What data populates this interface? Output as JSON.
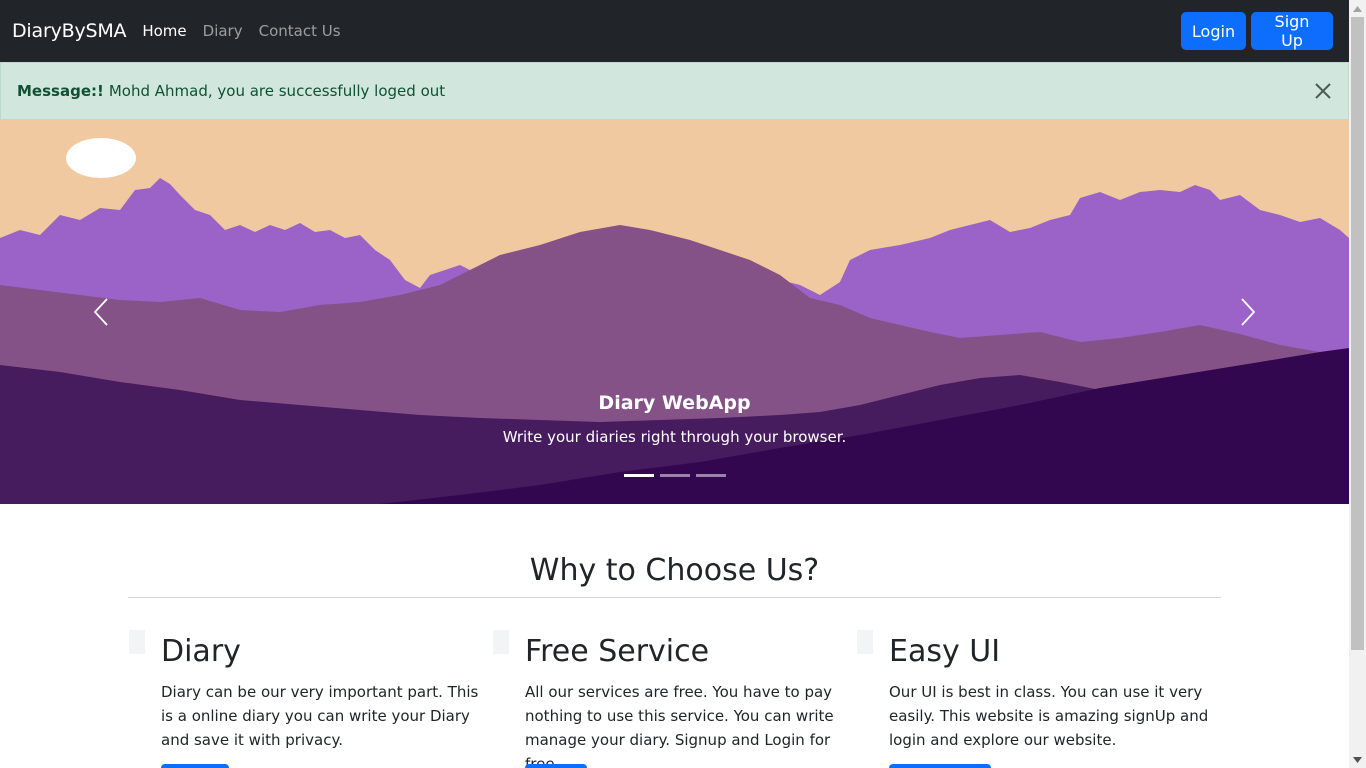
{
  "navbar": {
    "brand": "DiaryBySMA",
    "links": [
      {
        "label": "Home",
        "active": true
      },
      {
        "label": "Diary",
        "active": false
      },
      {
        "label": "Contact Us",
        "active": false
      }
    ],
    "login_label": "Login",
    "signup_label": "Sign Up"
  },
  "alert": {
    "label": "Message:!",
    "text": "Mohd Ahmad, you are successfully loged out"
  },
  "carousel": {
    "title": "Diary WebApp",
    "text": "Write your diaries right through your browser.",
    "slide_count": 3,
    "active_slide": 1
  },
  "why": {
    "title": "Why to Choose Us?",
    "features": [
      {
        "title": "Diary",
        "text": "Diary can be our very important part. This is a online diary you can write your Diary and save it with privacy."
      },
      {
        "title": "Free Service",
        "text": "All our services are free. You have to pay nothing to use this service. You can write manage your diary. Signup and Login for free."
      },
      {
        "title": "Easy UI",
        "text": "Our UI is best in class. You can use it very easily. This website is amazing signUp and login and explore our website."
      }
    ]
  },
  "colors": {
    "navbar_bg": "#212529",
    "primary": "#0d6efd",
    "alert_bg": "#d1e7dd",
    "alert_text": "#0f5132",
    "sky": "#f1c9a1",
    "mountain_light": "#9b62c8",
    "mountain_mid": "#845287",
    "mountain_dark": "#461c5e",
    "mountain_darkest": "#32074f"
  }
}
